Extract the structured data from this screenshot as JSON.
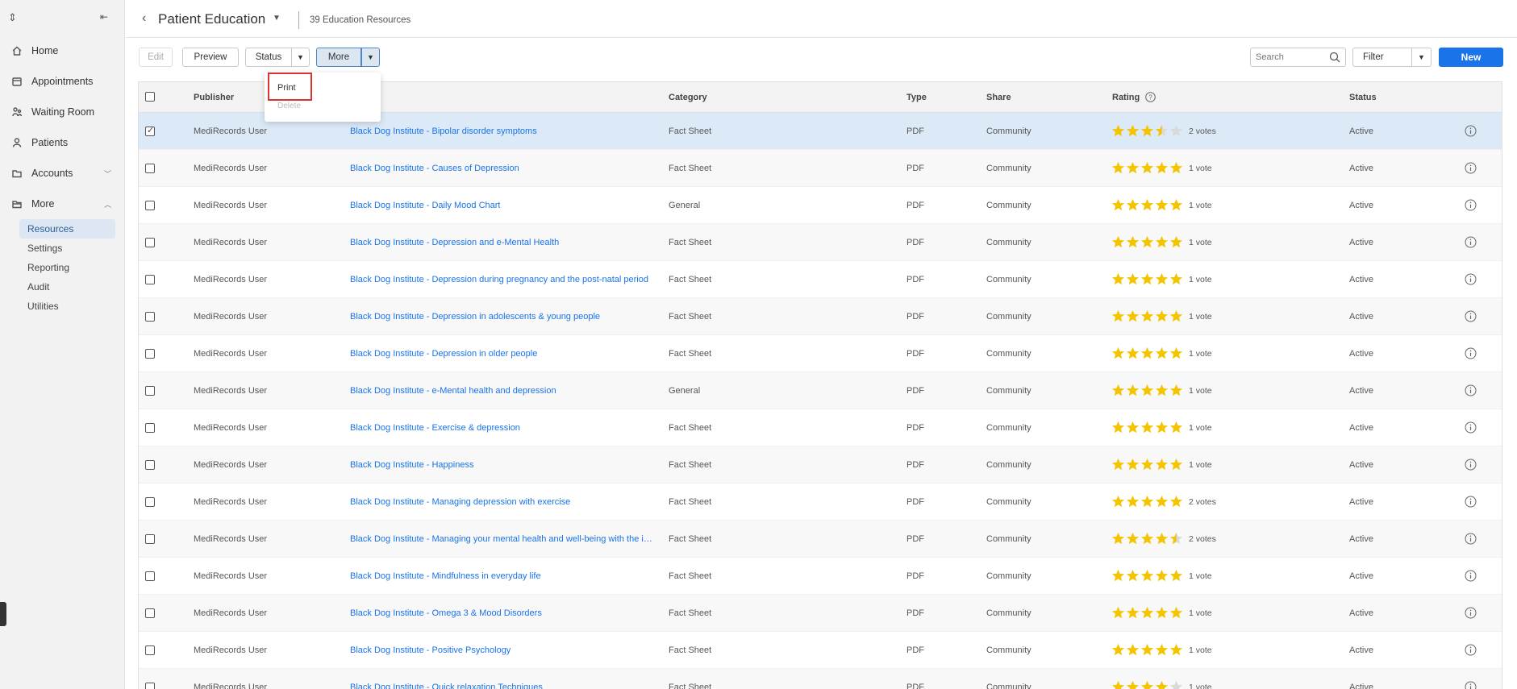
{
  "sidebar": {
    "items": [
      {
        "label": "Home",
        "icon": "home-icon"
      },
      {
        "label": "Appointments",
        "icon": "calendar-icon"
      },
      {
        "label": "Waiting Room",
        "icon": "waiting-room-icon"
      },
      {
        "label": "Patients",
        "icon": "patients-icon"
      },
      {
        "label": "Accounts",
        "icon": "folder-icon"
      },
      {
        "label": "More",
        "icon": "folder-open-icon"
      }
    ],
    "sub_items": [
      "Resources",
      "Settings",
      "Reporting",
      "Audit",
      "Utilities"
    ],
    "active_sub": "Resources"
  },
  "header": {
    "title": "Patient Education",
    "count": "39 Education Resources"
  },
  "toolbar": {
    "edit": "Edit",
    "preview": "Preview",
    "status": "Status",
    "more": "More",
    "search_placeholder": "Search",
    "filter": "Filter",
    "new": "New"
  },
  "dropdown": {
    "print": "Print",
    "delete": "Delete"
  },
  "table": {
    "columns": {
      "publisher": "Publisher",
      "category": "Category",
      "type": "Type",
      "share": "Share",
      "rating": "Rating",
      "status": "Status"
    },
    "rows": [
      {
        "publisher": "MediRecords User",
        "title": "Black Dog Institute - Bipolar disorder symptoms",
        "category": "Fact Sheet",
        "type": "PDF",
        "share": "Community",
        "rating": 3.5,
        "votes": "2 votes",
        "status": "Active",
        "selected": true
      },
      {
        "publisher": "MediRecords User",
        "title": "Black Dog Institute - Causes of Depression",
        "category": "Fact Sheet",
        "type": "PDF",
        "share": "Community",
        "rating": 5,
        "votes": "1 vote",
        "status": "Active"
      },
      {
        "publisher": "MediRecords User",
        "title": "Black Dog Institute - Daily Mood Chart",
        "category": "General",
        "type": "PDF",
        "share": "Community",
        "rating": 5,
        "votes": "1 vote",
        "status": "Active"
      },
      {
        "publisher": "MediRecords User",
        "title": "Black Dog Institute - Depression and e-Mental Health",
        "category": "Fact Sheet",
        "type": "PDF",
        "share": "Community",
        "rating": 5,
        "votes": "1 vote",
        "status": "Active"
      },
      {
        "publisher": "MediRecords User",
        "title": "Black Dog Institute - Depression during pregnancy and the post-natal period",
        "category": "Fact Sheet",
        "type": "PDF",
        "share": "Community",
        "rating": 5,
        "votes": "1 vote",
        "status": "Active"
      },
      {
        "publisher": "MediRecords User",
        "title": "Black Dog Institute - Depression in adolescents & young people",
        "category": "Fact Sheet",
        "type": "PDF",
        "share": "Community",
        "rating": 5,
        "votes": "1 vote",
        "status": "Active"
      },
      {
        "publisher": "MediRecords User",
        "title": "Black Dog Institute - Depression in older people",
        "category": "Fact Sheet",
        "type": "PDF",
        "share": "Community",
        "rating": 5,
        "votes": "1 vote",
        "status": "Active"
      },
      {
        "publisher": "MediRecords User",
        "title": "Black Dog Institute - e-Mental health and depression",
        "category": "General",
        "type": "PDF",
        "share": "Community",
        "rating": 5,
        "votes": "1 vote",
        "status": "Active"
      },
      {
        "publisher": "MediRecords User",
        "title": "Black Dog Institute - Exercise & depression",
        "category": "Fact Sheet",
        "type": "PDF",
        "share": "Community",
        "rating": 5,
        "votes": "1 vote",
        "status": "Active"
      },
      {
        "publisher": "MediRecords User",
        "title": "Black Dog Institute - Happiness",
        "category": "Fact Sheet",
        "type": "PDF",
        "share": "Community",
        "rating": 5,
        "votes": "1 vote",
        "status": "Active"
      },
      {
        "publisher": "MediRecords User",
        "title": "Black Dog Institute - Managing depression with exercise",
        "category": "Fact Sheet",
        "type": "PDF",
        "share": "Community",
        "rating": 5,
        "votes": "2 votes",
        "status": "Active"
      },
      {
        "publisher": "MediRecords User",
        "title": "Black Dog Institute - Managing your mental health and well-being with the internet",
        "category": "Fact Sheet",
        "type": "PDF",
        "share": "Community",
        "rating": 4.5,
        "votes": "2 votes",
        "status": "Active"
      },
      {
        "publisher": "MediRecords User",
        "title": "Black Dog Institute - Mindfulness in everyday life",
        "category": "Fact Sheet",
        "type": "PDF",
        "share": "Community",
        "rating": 5,
        "votes": "1 vote",
        "status": "Active"
      },
      {
        "publisher": "MediRecords User",
        "title": "Black Dog Institute - Omega 3 & Mood Disorders",
        "category": "Fact Sheet",
        "type": "PDF",
        "share": "Community",
        "rating": 5,
        "votes": "1 vote",
        "status": "Active"
      },
      {
        "publisher": "MediRecords User",
        "title": "Black Dog Institute - Positive Psychology",
        "category": "Fact Sheet",
        "type": "PDF",
        "share": "Community",
        "rating": 5,
        "votes": "1 vote",
        "status": "Active"
      },
      {
        "publisher": "MediRecords User",
        "title": "Black Dog Institute - Quick relaxation Techniques",
        "category": "Fact Sheet",
        "type": "PDF",
        "share": "Community",
        "rating": 4,
        "votes": "1 vote",
        "status": "Active"
      }
    ]
  },
  "colors": {
    "accent": "#1a73e8",
    "star": "#f5c400",
    "star_empty": "#d9d9d9",
    "highlight": "#e03131"
  }
}
